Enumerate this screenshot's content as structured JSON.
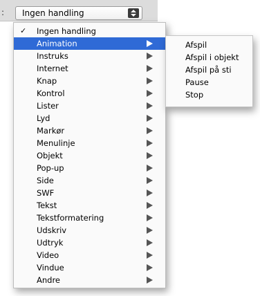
{
  "background": {
    "label_fragment": ":"
  },
  "popup": {
    "selected_value": "Ingen handling",
    "arrows_icon": "up-down-arrows-icon"
  },
  "menu": {
    "highlight_color": "#2f6ad6",
    "items": [
      {
        "label": "Ingen handling",
        "checked": true,
        "check_mark": "✓",
        "has_submenu": false,
        "highlighted": false
      },
      {
        "label": "Animation",
        "checked": false,
        "has_submenu": true,
        "highlighted": true
      },
      {
        "label": "Instruks",
        "checked": false,
        "has_submenu": true,
        "highlighted": false
      },
      {
        "label": "Internet",
        "checked": false,
        "has_submenu": true,
        "highlighted": false
      },
      {
        "label": "Knap",
        "checked": false,
        "has_submenu": true,
        "highlighted": false
      },
      {
        "label": "Kontrol",
        "checked": false,
        "has_submenu": true,
        "highlighted": false
      },
      {
        "label": "Lister",
        "checked": false,
        "has_submenu": true,
        "highlighted": false
      },
      {
        "label": "Lyd",
        "checked": false,
        "has_submenu": true,
        "highlighted": false
      },
      {
        "label": "Markør",
        "checked": false,
        "has_submenu": true,
        "highlighted": false
      },
      {
        "label": "Menulinje",
        "checked": false,
        "has_submenu": true,
        "highlighted": false
      },
      {
        "label": "Objekt",
        "checked": false,
        "has_submenu": true,
        "highlighted": false
      },
      {
        "label": "Pop-up",
        "checked": false,
        "has_submenu": true,
        "highlighted": false
      },
      {
        "label": "Side",
        "checked": false,
        "has_submenu": true,
        "highlighted": false
      },
      {
        "label": "SWF",
        "checked": false,
        "has_submenu": true,
        "highlighted": false
      },
      {
        "label": "Tekst",
        "checked": false,
        "has_submenu": true,
        "highlighted": false
      },
      {
        "label": "Tekstformatering",
        "checked": false,
        "has_submenu": true,
        "highlighted": false
      },
      {
        "label": "Udskriv",
        "checked": false,
        "has_submenu": true,
        "highlighted": false
      },
      {
        "label": "Udtryk",
        "checked": false,
        "has_submenu": true,
        "highlighted": false
      },
      {
        "label": "Video",
        "checked": false,
        "has_submenu": true,
        "highlighted": false
      },
      {
        "label": "Vindue",
        "checked": false,
        "has_submenu": true,
        "highlighted": false
      },
      {
        "label": "Andre",
        "checked": false,
        "has_submenu": true,
        "highlighted": false
      }
    ]
  },
  "submenu": {
    "parent": "Animation",
    "items": [
      {
        "label": "Afspil"
      },
      {
        "label": "Afspil i objekt"
      },
      {
        "label": "Afspil på sti"
      },
      {
        "label": "Pause"
      },
      {
        "label": "Stop"
      }
    ]
  }
}
